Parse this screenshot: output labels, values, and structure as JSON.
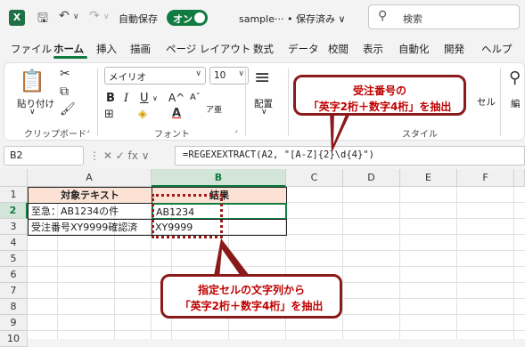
{
  "titlebar": {
    "app_icon": "X",
    "autosave_label": "自動保存",
    "autosave_state": "オン",
    "filename": "sample··· • 保存済み ∨",
    "search_placeholder": "検索"
  },
  "tabs": [
    "ファイル",
    "ホーム",
    "挿入",
    "描画",
    "ページ レイアウト",
    "数式",
    "データ",
    "校閲",
    "表示",
    "自動化",
    "開発",
    "ヘルプ"
  ],
  "active_tab": "ホーム",
  "ribbon": {
    "paste_label": "貼り付け",
    "clipboard_label": "クリップボード",
    "font_name": "メイリオ",
    "font_size": "10",
    "font_group_label": "フォント",
    "align_label": "配置",
    "style_label": "スタイル",
    "cell_label": "セル",
    "edit_label": "編",
    "bold": "B",
    "italic": "I",
    "underline": "U",
    "grow_font": "A^",
    "shrink_font": "Aˇ",
    "phonetic": "ア亜"
  },
  "formula_bar": {
    "name_box": "B2",
    "fx_symbols": "⋮  ✕  ✓  fx  ∨",
    "formula": "=REGEXEXTRACT(A2, \"[A-Z]{2}\\d{4}\")"
  },
  "columns": [
    "A",
    "B",
    "C",
    "D",
    "E",
    "F"
  ],
  "rows": [
    "1",
    "2",
    "3",
    "4",
    "5",
    "6",
    "7",
    "8",
    "9",
    "10"
  ],
  "table": {
    "header_a": "対象テキスト",
    "header_b": "結果",
    "a2": "至急：AB1234の件",
    "b2": "AB1234",
    "a3": "受注番号XY9999確認済",
    "b3": "XY9999"
  },
  "callouts": {
    "top_line1": "受注番号の",
    "top_line2": "「英字2桁＋数字4桁」を抽出",
    "bottom_line1": "指定セルの文字列から",
    "bottom_line2": "「英字2桁＋数字4桁」を抽出"
  },
  "colors": {
    "excel_green": "#107c41",
    "callout_border": "#8b1a1a",
    "callout_text": "#c00000",
    "header_fill": "#fbe2d5"
  }
}
